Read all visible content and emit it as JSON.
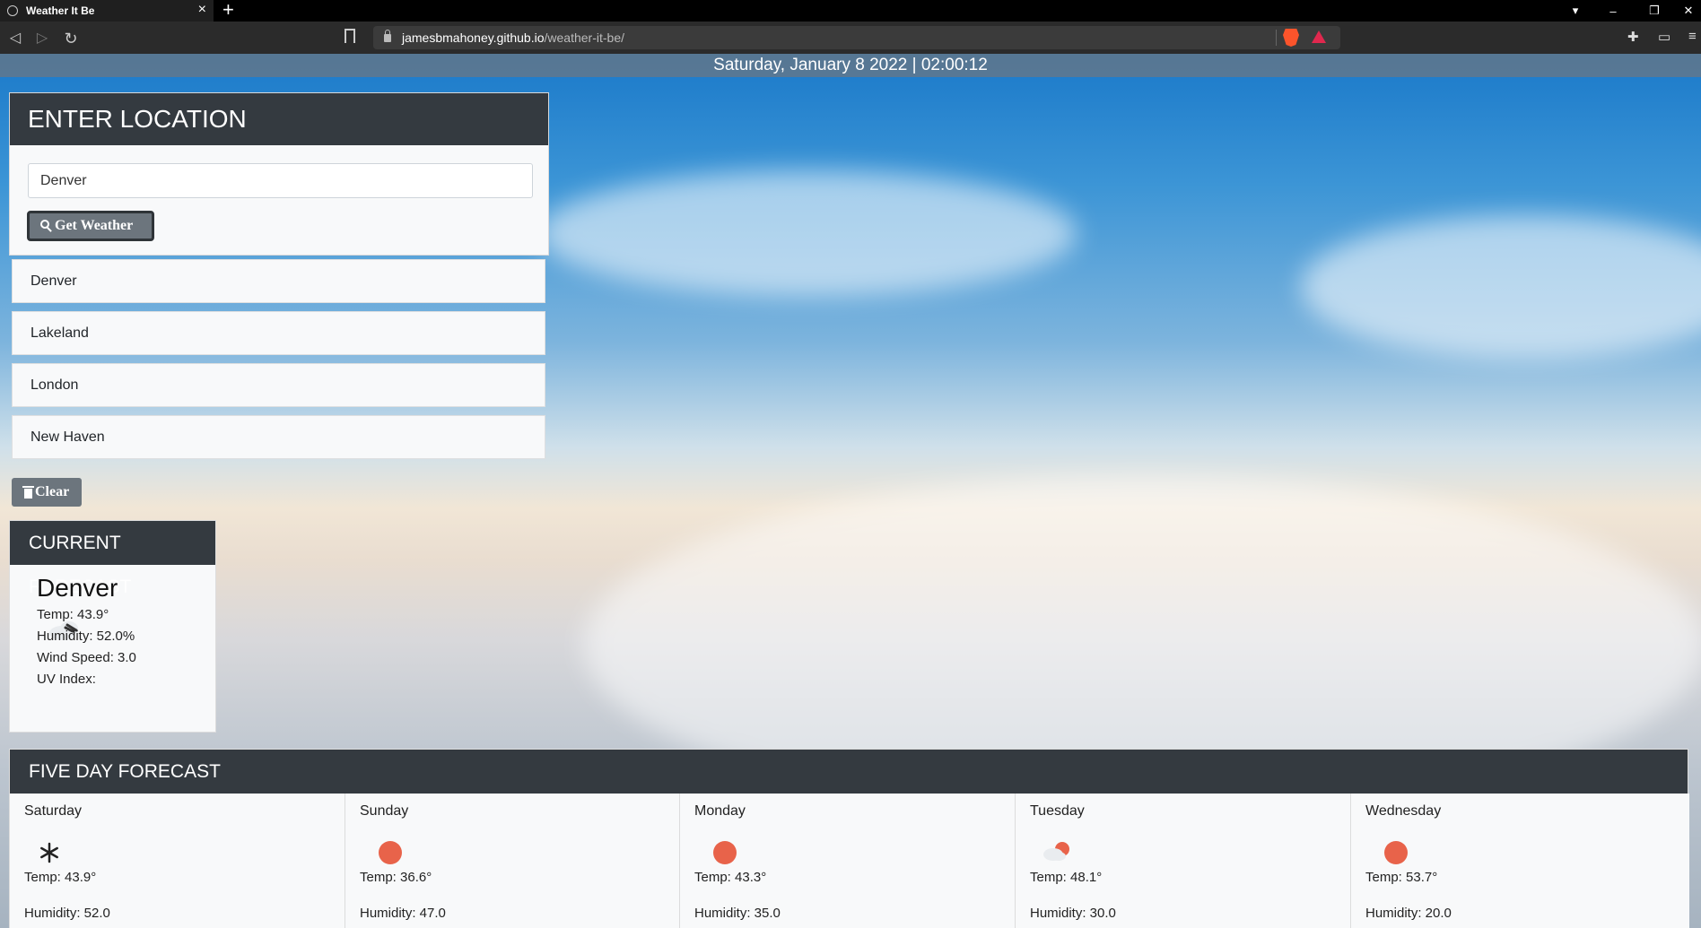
{
  "browser": {
    "tab_title": "Weather It Be",
    "url_host": "jamesbmahoney.github.io",
    "url_path": "/weather-it-be/"
  },
  "datetime": "Saturday, January 8 2022 | 02:00:12",
  "location_panel": {
    "title": "ENTER LOCATION",
    "input_value": "Denver",
    "get_weather_label": "Get Weather"
  },
  "history": [
    "Denver",
    "Lakeland",
    "London",
    "New Haven"
  ],
  "clear_label": "Clear",
  "current": {
    "title": "CURRENT FORECAST",
    "city": "Denver",
    "icon": "cloud-wind-icon",
    "temp": "Temp: 43.9°",
    "humidity": "Humidity: 52.0%",
    "wind": "Wind Speed: 3.0",
    "uv": "UV Index:"
  },
  "five_day": {
    "title": "FIVE DAY FORECAST",
    "days": [
      {
        "name": "Saturday",
        "icon": "snowflake-icon",
        "temp": "Temp: 43.9°",
        "humidity": "Humidity: 52.0"
      },
      {
        "name": "Sunday",
        "icon": "sun-icon",
        "temp": "Temp: 36.6°",
        "humidity": "Humidity: 47.0"
      },
      {
        "name": "Monday",
        "icon": "sun-icon",
        "temp": "Temp: 43.3°",
        "humidity": "Humidity: 35.0"
      },
      {
        "name": "Tuesday",
        "icon": "partly-cloudy-icon",
        "temp": "Temp: 48.1°",
        "humidity": "Humidity: 30.0"
      },
      {
        "name": "Wednesday",
        "icon": "sun-icon",
        "temp": "Temp: 53.7°",
        "humidity": "Humidity: 20.0"
      }
    ]
  },
  "colors": {
    "header_dark": "#343a40",
    "button_gray": "#6c757d",
    "sun_orange": "#e8634a"
  }
}
